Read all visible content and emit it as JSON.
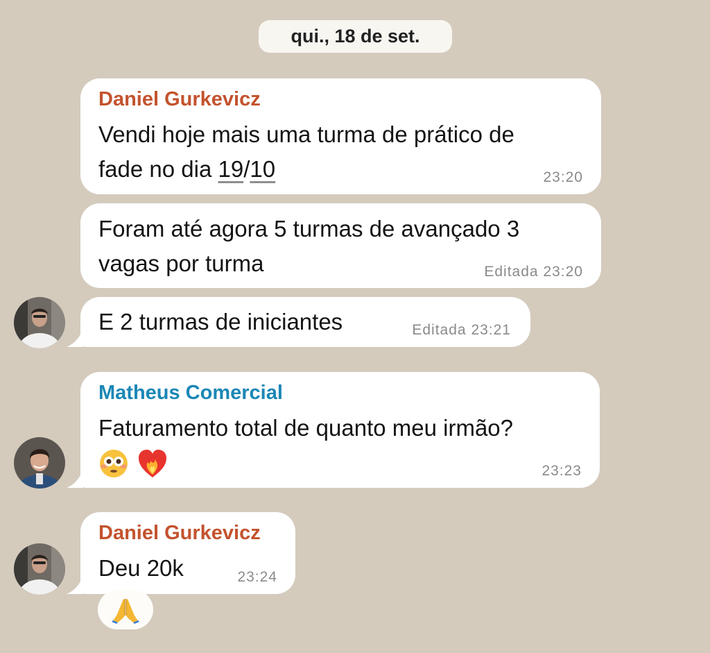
{
  "date_divider": "qui., 18 de set.",
  "messages": [
    {
      "sender": "Daniel Gurkevicz",
      "line1": "Vendi hoje mais uma turma de prático de",
      "line2_prefix": "fade no dia ",
      "line2_date_a": "19",
      "line2_slash": "/",
      "line2_date_b": "10",
      "time": "23:20"
    },
    {
      "line1": "Foram até agora 5 turmas de avançado 3",
      "line2": "vagas por turma",
      "edited_label": "Editada",
      "time": "23:20"
    },
    {
      "line1": "E 2 turmas de iniciantes",
      "edited_label": "Editada",
      "time": "23:21"
    },
    {
      "sender": "Matheus Comercial",
      "line1": "Faturamento total de quanto meu irmão?",
      "emojis": [
        "flushed-face",
        "heart-on-fire"
      ],
      "time": "23:23"
    },
    {
      "sender": "Daniel Gurkevicz",
      "line1": "Deu 20k",
      "time": "23:24",
      "reaction": "folded-hands"
    }
  ],
  "colors": {
    "background": "#d4cbbd",
    "bubble": "#ffffff",
    "sender_daniel": "#c3532e",
    "sender_matheus": "#1b87b6",
    "meta_text": "#8a8a8a"
  }
}
